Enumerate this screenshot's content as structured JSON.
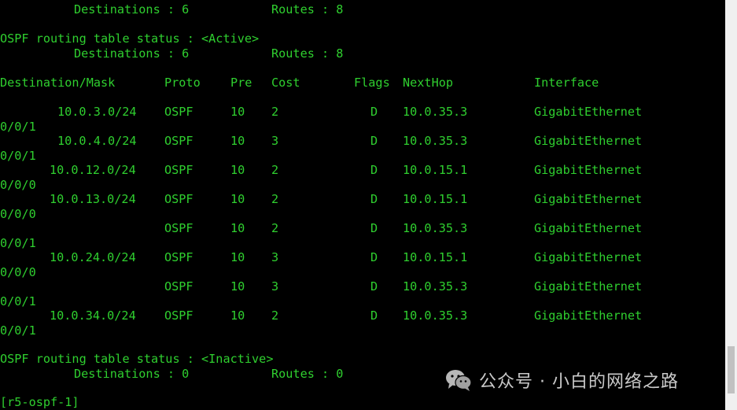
{
  "summary_top": {
    "destinations": "Destinations : 6",
    "routes": "Routes : 8"
  },
  "active_status": {
    "title": "OSPF routing table status : <Active>",
    "destinations": "Destinations : 6",
    "routes": "Routes : 8"
  },
  "table_header": {
    "destination": "Destination/Mask",
    "proto": "Proto",
    "pre": "Pre",
    "cost": "Cost",
    "flags": "Flags",
    "nexthop": "NextHop",
    "interface": "Interface"
  },
  "routes": [
    {
      "dest": "10.0.3.0/24",
      "proto": "OSPF",
      "pre": "10",
      "cost": "2",
      "flags": "D",
      "nexthop": "10.0.35.3",
      "iface": "GigabitEthernet",
      "iface_cont": "0/0/1"
    },
    {
      "dest": "10.0.4.0/24",
      "proto": "OSPF",
      "pre": "10",
      "cost": "3",
      "flags": "D",
      "nexthop": "10.0.35.3",
      "iface": "GigabitEthernet",
      "iface_cont": "0/0/1"
    },
    {
      "dest": "10.0.12.0/24",
      "proto": "OSPF",
      "pre": "10",
      "cost": "2",
      "flags": "D",
      "nexthop": "10.0.15.1",
      "iface": "GigabitEthernet",
      "iface_cont": "0/0/0"
    },
    {
      "dest": "10.0.13.0/24",
      "proto": "OSPF",
      "pre": "10",
      "cost": "2",
      "flags": "D",
      "nexthop": "10.0.15.1",
      "iface": "GigabitEthernet",
      "iface_cont": "0/0/0"
    },
    {
      "dest": "",
      "proto": "OSPF",
      "pre": "10",
      "cost": "2",
      "flags": "D",
      "nexthop": "10.0.35.3",
      "iface": "GigabitEthernet",
      "iface_cont": "0/0/1"
    },
    {
      "dest": "10.0.24.0/24",
      "proto": "OSPF",
      "pre": "10",
      "cost": "3",
      "flags": "D",
      "nexthop": "10.0.15.1",
      "iface": "GigabitEthernet",
      "iface_cont": "0/0/0"
    },
    {
      "dest": "",
      "proto": "OSPF",
      "pre": "10",
      "cost": "3",
      "flags": "D",
      "nexthop": "10.0.35.3",
      "iface": "GigabitEthernet",
      "iface_cont": "0/0/1"
    },
    {
      "dest": "10.0.34.0/24",
      "proto": "OSPF",
      "pre": "10",
      "cost": "2",
      "flags": "D",
      "nexthop": "10.0.35.3",
      "iface": "GigabitEthernet",
      "iface_cont": "0/0/1"
    }
  ],
  "inactive_status": {
    "title": "OSPF routing table status : <Inactive>",
    "destinations": "Destinations : 0",
    "routes": "Routes : 0"
  },
  "prompt": "[r5-ospf-1]",
  "watermark": {
    "icon": "wechat-icon",
    "text": "公众号 · 小白的网络之路"
  },
  "colors": {
    "terminal_text": "#2fcf2f",
    "terminal_bg": "#000000"
  }
}
